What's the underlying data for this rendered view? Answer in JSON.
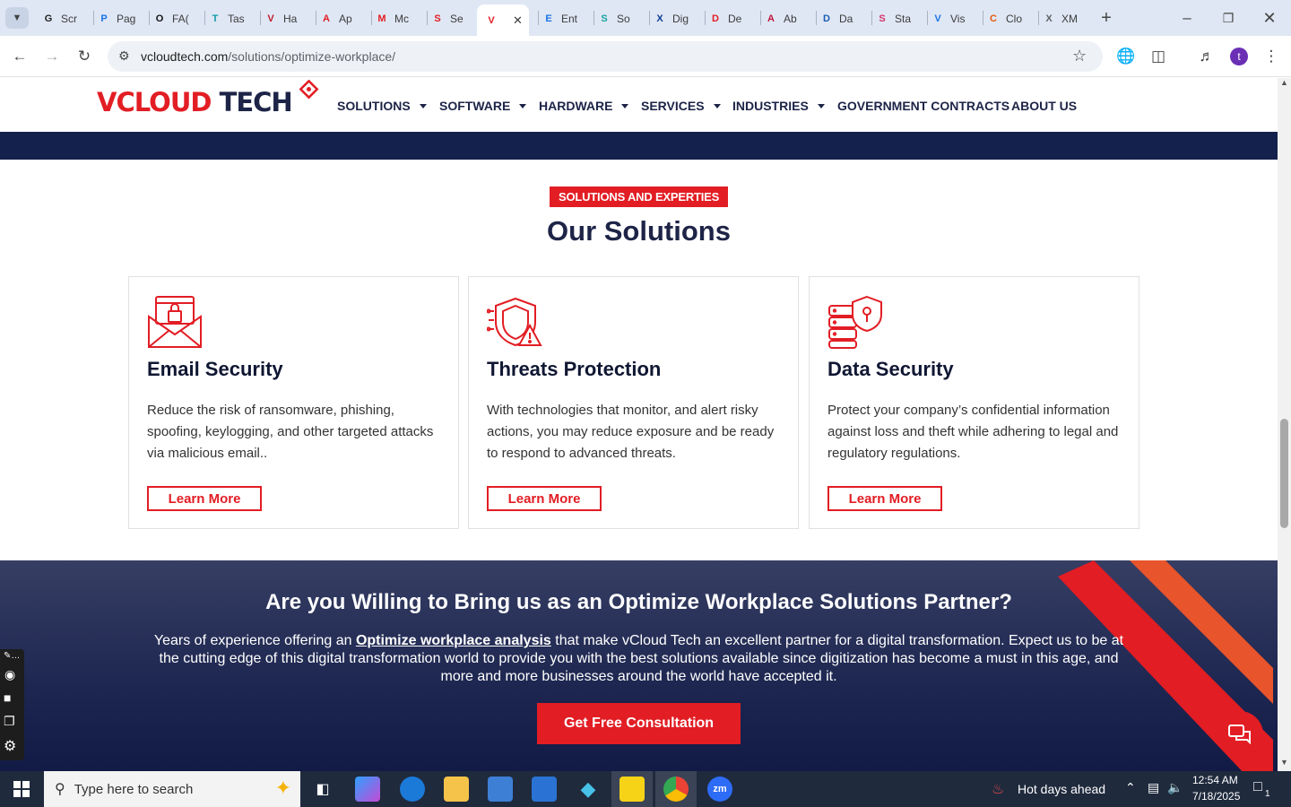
{
  "browser": {
    "tabs": [
      {
        "label": "Scr",
        "icon": "G",
        "color": "#222"
      },
      {
        "label": "Pag",
        "icon": "P",
        "color": "#1a73e8"
      },
      {
        "label": "FA(",
        "icon": "O",
        "color": "#111"
      },
      {
        "label": "Tas",
        "icon": "T",
        "color": "#0f9ba8"
      },
      {
        "label": "Ha",
        "icon": "V",
        "color": "#c01d2b"
      },
      {
        "label": "Ap",
        "icon": "A",
        "color": "#e21d24"
      },
      {
        "label": "Mc",
        "icon": "M",
        "color": "#e21d24"
      },
      {
        "label": "Se",
        "icon": "S",
        "color": "#e21d24"
      },
      {
        "label": "",
        "icon": "V",
        "color": "#e21d24",
        "active": true
      },
      {
        "label": "Ent",
        "icon": "E",
        "color": "#1a73e8"
      },
      {
        "label": "So",
        "icon": "S",
        "color": "#1aa3a3"
      },
      {
        "label": "Dig",
        "icon": "X",
        "color": "#0b3d91"
      },
      {
        "label": "De",
        "icon": "D",
        "color": "#e21d24"
      },
      {
        "label": "Ab",
        "icon": "A",
        "color": "#c0163a"
      },
      {
        "label": "Da",
        "icon": "D",
        "color": "#1a5fb4"
      },
      {
        "label": "Sta",
        "icon": "S",
        "color": "#d6336c"
      },
      {
        "label": "Vis",
        "icon": "V",
        "color": "#1a73e8"
      },
      {
        "label": "Clo",
        "icon": "C",
        "color": "#e8590c"
      },
      {
        "label": "XM",
        "icon": "X",
        "color": "#5f6368"
      }
    ],
    "url_host": "vcloudtech.com",
    "url_path": "/solutions/optimize-workplace/",
    "profile_initial": "t"
  },
  "nav": {
    "logo_part1": "VCLOUD",
    "logo_part2": "TECH",
    "items": [
      "SOLUTIONS",
      "SOFTWARE",
      "HARDWARE",
      "SERVICES",
      "INDUSTRIES",
      "GOVERNMENT CONTRACTS",
      "ABOUT US"
    ]
  },
  "solutions": {
    "kicker": "SOLUTIONS AND EXPERTIES",
    "heading": "Our Solutions",
    "cards": [
      {
        "title": "Email Security",
        "text": "Reduce the risk of ransomware, phishing, spoofing, keylogging, and other targeted attacks via malicious email..",
        "button": "Learn More",
        "icon": "email-lock-icon"
      },
      {
        "title": "Threats Protection",
        "text": "With technologies that monitor, and alert risky actions, you may reduce exposure and be ready to respond to advanced threats.",
        "button": "Learn More",
        "icon": "shield-alert-icon"
      },
      {
        "title": "Data Security",
        "text": "Protect your company’s confidential information against loss and theft while adhering to legal and regulatory regulations.",
        "button": "Learn More",
        "icon": "server-shield-icon"
      }
    ]
  },
  "cta": {
    "title": "Are you Willing to Bring us as an Optimize Workplace Solutions Partner?",
    "text_before": "Years of experience offering an ",
    "link": "Optimize workplace analysis",
    "text_after": " that make vCloud Tech an excellent partner for a digital transformation. Expect us to be at the cutting edge of this digital transformation world to provide you with the best solutions available since digitization has become a must in this age, and more and more businesses around the world have accepted it.",
    "button": "Get Free Consultation"
  },
  "taskbar": {
    "search_placeholder": "Type here to search",
    "weather": "Hot days ahead",
    "time": "12:54 AM",
    "date": "7/18/2025",
    "notifications": "1"
  },
  "colors": {
    "accent": "#e21d24",
    "navy": "#1d2447",
    "band": "#15214d"
  }
}
